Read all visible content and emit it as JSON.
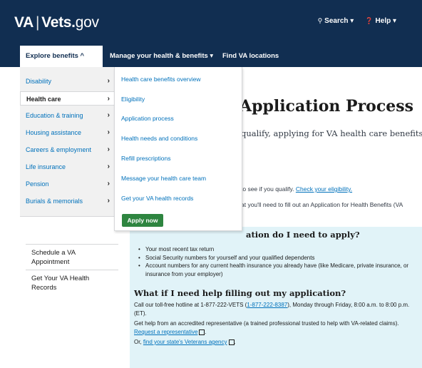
{
  "header": {
    "logo_va": "VA",
    "logo_sep": "|",
    "logo_vets": "Vets.",
    "logo_gov": "gov",
    "search_label": "Search ▾",
    "help_label": "Help ▾"
  },
  "nav": {
    "explore": "Explore benefits ^",
    "manage": "Manage your health & benefits ▾",
    "find": "Find VA locations"
  },
  "menu": {
    "categories": [
      {
        "label": "Disability"
      },
      {
        "label": "Health care"
      },
      {
        "label": "Education & training"
      },
      {
        "label": "Housing assistance"
      },
      {
        "label": "Careers & employment"
      },
      {
        "label": "Life insurance"
      },
      {
        "label": "Pension"
      },
      {
        "label": "Burials & memorials"
      }
    ],
    "chevron": "›",
    "sub_items": [
      {
        "label": "Health care benefits overview"
      },
      {
        "label": "Eligibility"
      },
      {
        "label": "Application process"
      },
      {
        "label": "Health needs and conditions"
      },
      {
        "label": "Refill prescriptions"
      },
      {
        "label": "Message your health care team"
      },
      {
        "label": "Get your VA health records"
      }
    ],
    "apply_button": "Apply now"
  },
  "main": {
    "title": "Application Process",
    "intro_line": "qualify, applying for VA health care benefits is",
    "check_text": "to see if you qualify.",
    "check_link": "Check your eligibility.",
    "need_text": "at you'll need to fill out an Application for Health Benefits (VA"
  },
  "sidebar": {
    "items": [
      {
        "label": "Schedule a VA Appointment"
      },
      {
        "label": "Get Your VA Health Records"
      }
    ]
  },
  "panel": {
    "heading": "ation do I need to apply?",
    "bullets": [
      "Your most recent tax return",
      "Social Security numbers for yourself and your qualified dependents",
      "Account numbers for any current health insurance you already have (like Medicare, private insurance, or insurance from your employer)"
    ],
    "help_heading": "What if I need help filling out my application?",
    "hotline_text": "Call our toll-free hotline at 1-877-222-VETS (",
    "hotline_link": "1-877-222-8387",
    "hotline_rest": "), Monday through Friday, 8:00 a.m. to 8:00 p.m. (ET).",
    "rep_text": "Get help from an accredited representative (a trained professional trusted to help with VA-related claims).",
    "rep_link": "Request a representative",
    "agency_prefix": "Or,",
    "agency_link": "find your state's Veterans agency",
    "end_dot": "."
  }
}
